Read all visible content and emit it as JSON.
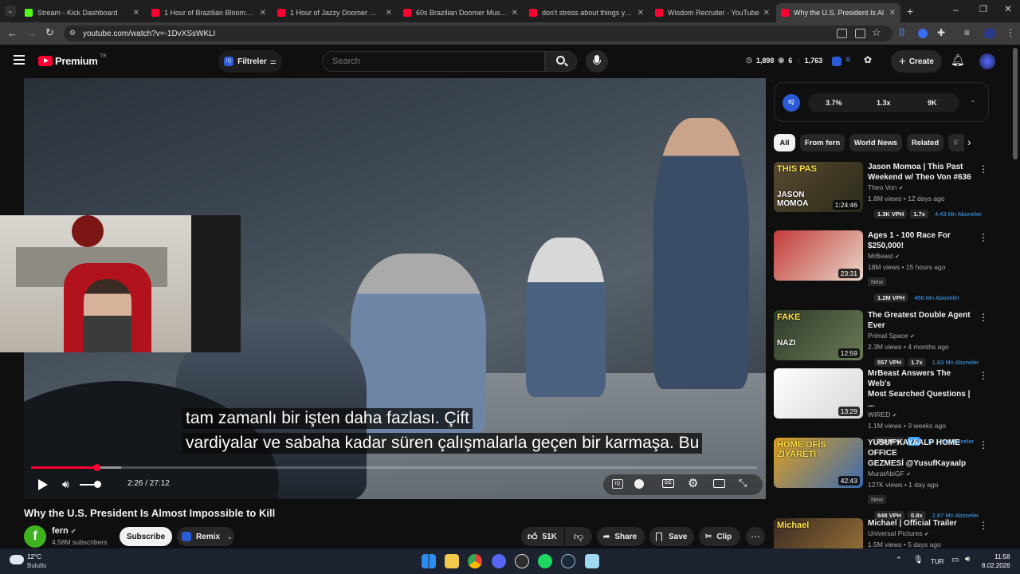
{
  "browser": {
    "tabs": [
      {
        "title": "Stream - Kick Dashboard",
        "fav": "#53fc18"
      },
      {
        "title": "1 Hour of Brazilian Bloomer Mu",
        "fav": "#ff0033"
      },
      {
        "title": "1 Hour of Jazzy Doomer Music",
        "fav": "#ff0033"
      },
      {
        "title": "60s Brazilian Doomer Music - F",
        "fav": "#ff0033"
      },
      {
        "title": "don't stress about things you c",
        "fav": "#ff0033"
      },
      {
        "title": "Wisdom Recruiter - YouTube",
        "fav": "#ff0033"
      },
      {
        "title": "Why the U.S. President Is Al",
        "fav": "#ff0033"
      }
    ],
    "url": "youtube.com/watch?v=-1DvXSsWKLI"
  },
  "header": {
    "brand": "Premium",
    "region": "TR",
    "filter_label": "Filtreler",
    "search_placeholder": "Search",
    "stats": [
      "1,898",
      "6",
      "1,763"
    ],
    "create_label": "Create"
  },
  "player": {
    "caption_line1": "tam zamanlı bir işten daha fazlası.  Çift",
    "caption_line2": "vardiyalar ve sabaha kadar süren çalışmalarla geçen bir karmaşa.   Bu",
    "time": "2:26 / 27:12",
    "progress": 0.0895
  },
  "video": {
    "title": "Why the U.S. President Is Almost Impossible to Kill",
    "channel": "fern",
    "subscribers": "4.58M subscribers",
    "subscribe_label": "Subscribe",
    "remix_label": "Remix",
    "likes": "51K",
    "share_label": "Share",
    "save_label": "Save",
    "clip_label": "Clip"
  },
  "sidebar": {
    "iq_stats": [
      "3.7%",
      "1.3x",
      "9K"
    ],
    "chips": [
      "All",
      "From fern",
      "World News",
      "Related",
      "F"
    ],
    "recommendations": [
      {
        "title1": "Jason Momoa | This Past",
        "title2": "Weekend w/ Theo Von #636",
        "channel": "Theo Von",
        "meta": "1.8M views • 12 days ago",
        "new": "",
        "vph": "1.3K VPH",
        "mult": "1.7x",
        "subs": "4.43 Mn Aboneler",
        "duration": "1:24:46",
        "thumb_text1": "THIS PAS",
        "thumb_text2": "JASON MOMOA"
      },
      {
        "title1": "Ages 1 - 100 Race For",
        "title2": "$250,000!",
        "channel": "MrBeast",
        "meta": "18M views • 15 hours ago",
        "new": "New",
        "vph": "1.2M VPH",
        "mult": "",
        "subs": "466 Mn Aboneler",
        "duration": "23:31",
        "thumb_text1": "",
        "thumb_text2": ""
      },
      {
        "title1": "The Greatest Double Agent Ever",
        "title2": "",
        "channel": "Primal Space",
        "meta": "2.3M views • 4 months ago",
        "new": "",
        "vph": "557 VPH",
        "mult": "1.7x",
        "subs": "1.83 Mn Aboneler",
        "duration": "12:59",
        "thumb_text1": "FAKE",
        "thumb_text2": "NAZI"
      },
      {
        "title1": "MrBeast Answers The Web's",
        "title2": "Most Searched Questions | ...",
        "channel": "WIRED",
        "meta": "1.1M views • 3 weeks ago",
        "new": "",
        "vph": "748 VPH",
        "mult": "3x",
        "subs": "12.7 Mn Aboneler",
        "duration": "13:29",
        "thumb_text1": "",
        "thumb_text2": ""
      },
      {
        "title1": "YUSUF KAYAALP HOME OFFICE",
        "title2": "GEZMESİ @YusufKayaalp",
        "channel": "MuratAbiGF",
        "meta": "127K views • 1 day ago",
        "new": "New",
        "vph": "848 VPH",
        "mult": "0.8x",
        "subs": "2.87 Mn Aboneler",
        "duration": "42:43",
        "thumb_text1": "HOME OFİS ZİYARETİ",
        "thumb_text2": ""
      },
      {
        "title1": "Michael | Official Trailer",
        "title2": "",
        "channel": "Universal Pictures",
        "meta": "1.5M views • 5 days ago",
        "new": "",
        "vph": "",
        "mult": "",
        "subs": "",
        "duration": "",
        "thumb_text1": "Michael",
        "thumb_text2": ""
      }
    ]
  },
  "taskbar": {
    "weather_temp": "12°C",
    "weather_desc": "Bulutlu",
    "lang": "TUR",
    "time": "11:58",
    "date": "8.02.2026"
  },
  "colors": {
    "yt_red": "#ff0033",
    "link_blue": "#3ea6ff",
    "bg": "#0f0f0f",
    "chip_bg": "#272727"
  }
}
